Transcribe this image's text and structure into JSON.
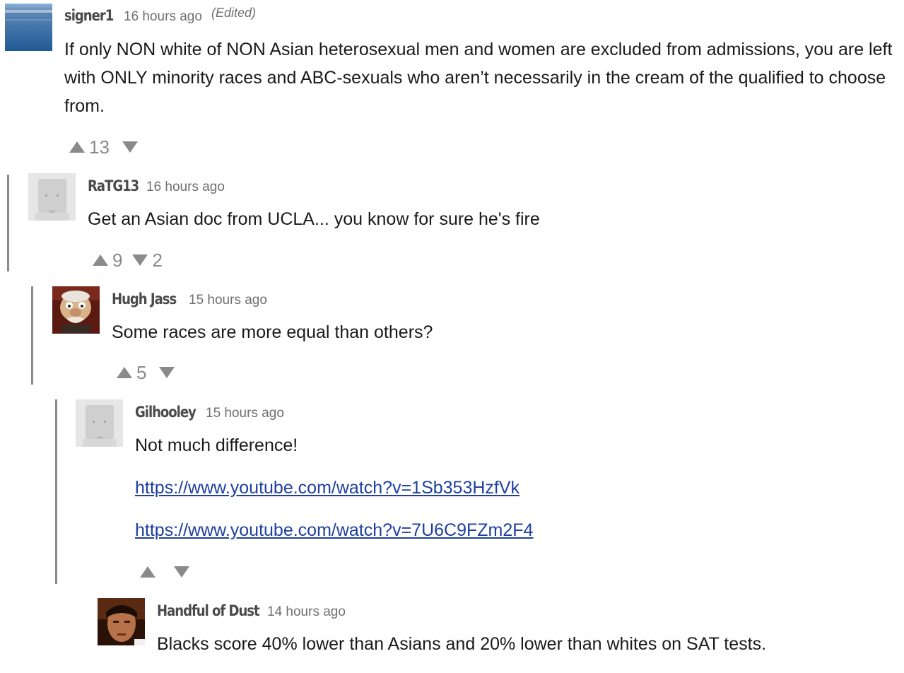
{
  "comments": [
    {
      "author": "signer1",
      "time": "16 hours ago",
      "edited": "(Edited)",
      "body": "If only NON white of NON Asian heterosexual men and women are excluded from admissions, you are left with ONLY minority races and ABC-sexuals who aren’t necessarily in the cream of the qualified to choose from.",
      "upvotes": "13",
      "downvotes": ""
    },
    {
      "author": "RaTG13",
      "time": "16 hours ago",
      "body": "Get an Asian doc from UCLA... you know for sure he's fire",
      "upvotes": "9",
      "downvotes": "2"
    },
    {
      "author": "Hugh Jass",
      "time": "15 hours ago",
      "body": "Some races are more equal than others?",
      "upvotes": "5",
      "downvotes": ""
    },
    {
      "author": "Gilhooley",
      "time": "15 hours ago",
      "body": "Not much difference!",
      "links": [
        "https://www.youtube.com/watch?v=1Sb353HzfVk",
        "https://www.youtube.com/watch?v=7U6C9FZm2F4"
      ],
      "upvotes": "",
      "downvotes": ""
    },
    {
      "author": "Handful of Dust",
      "time": "14 hours ago",
      "body": "Blacks score 40% lower than Asians and 20% lower than whites on SAT tests."
    }
  ],
  "colors": {
    "thread_line": "#8a8a8a",
    "link": "#1f3fa0",
    "vote_arrow": "#8a8a8a"
  }
}
